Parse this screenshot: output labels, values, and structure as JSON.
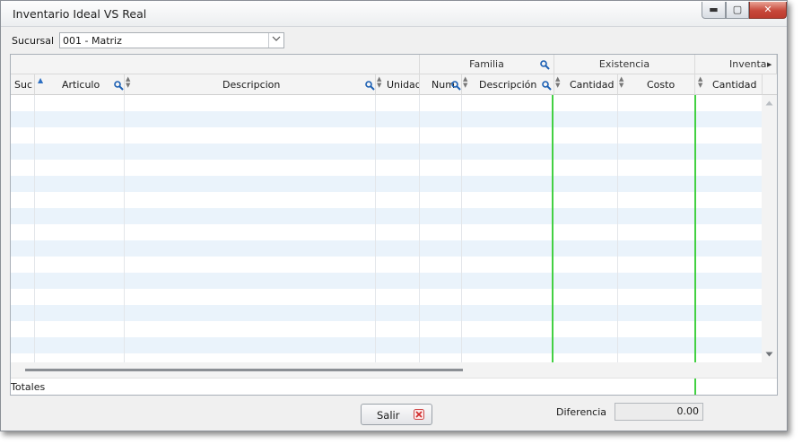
{
  "window": {
    "title": "Inventario Ideal VS Real",
    "controls": {
      "minimize": "▬",
      "maximize": "▢",
      "close": "✕"
    }
  },
  "filter": {
    "sucursal_label": "Sucursal",
    "sucursal_value": "001 - Matriz",
    "dropdown_icon": "chevron-down-icon"
  },
  "grid": {
    "groups": {
      "familia": "Familia",
      "existencia": "Existencia",
      "inventario": "Inventa"
    },
    "columns": {
      "suc": "Suc",
      "articulo": "Articulo",
      "descripcion": "Descripcion",
      "unidad": "Unidad",
      "num": "Num",
      "fam_descripcion": "Descripción",
      "exist_cantidad": "Cantidad",
      "exist_costo": "Costo",
      "inv_cantidad": "Cantidad"
    },
    "row_count": 16,
    "accent_separator_color": "#43d043",
    "row_alt_color": "#eaf3fb",
    "totals_label": "Totales"
  },
  "footer": {
    "salir_label": "Salir",
    "diferencia_label": "Diferencia",
    "diferencia_value": "0.00"
  }
}
